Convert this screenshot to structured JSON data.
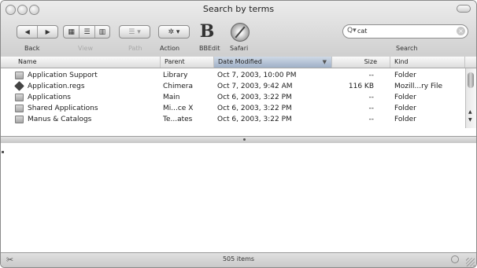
{
  "window": {
    "title": "Search by terms"
  },
  "toolbar": {
    "back_forward_glyphs": [
      "◀",
      "▶"
    ],
    "view_glyphs": [
      "▦",
      "☰",
      "▥"
    ],
    "path_glyph": "☰ ▾",
    "action_glyph": "✲ ▾",
    "bbedit_glyph": "B",
    "labels": {
      "back": "Back",
      "view": "View",
      "path": "Path",
      "action": "Action",
      "bbedit": "BBEdit",
      "safari": "Safari",
      "search": "Search"
    }
  },
  "search": {
    "value": "cat",
    "placeholder": "",
    "glyph": "Q▾",
    "clear_glyph": "×"
  },
  "columns": {
    "name": "Name",
    "parent": "Parent",
    "date_modified": "Date Modified",
    "size": "Size",
    "kind": "Kind",
    "sort_glyph": "▼"
  },
  "files": [
    {
      "name": "Application Support",
      "parent": "Library",
      "date": "Oct 7, 2003, 10:00 PM",
      "size": "--",
      "kind": "Folder",
      "icon": "folder-icon"
    },
    {
      "name": "Application.regs",
      "parent": "Chimera",
      "date": "Oct 7, 2003, 9:42 AM",
      "size": "116 KB",
      "kind": "Mozill...ry File",
      "icon": "application-file-icon"
    },
    {
      "name": "Applications",
      "parent": "Main",
      "date": "Oct 6, 2003, 3:22 PM",
      "size": "--",
      "kind": "Folder",
      "icon": "folder-icon"
    },
    {
      "name": "Shared Applications",
      "parent": "Mi...ce X",
      "date": "Oct 6, 2003, 3:22 PM",
      "size": "--",
      "kind": "Folder",
      "icon": "folder-icon"
    },
    {
      "name": "Manus & Catalogs",
      "parent": "Te...ates",
      "date": "Oct 6, 2003, 3:22 PM",
      "size": "--",
      "kind": "Folder",
      "icon": "folder-icon"
    }
  ],
  "scrollbar": {
    "up_glyph": "▲",
    "down_glyph": "▼"
  },
  "status": {
    "text": "505 items",
    "tools_glyph": "✂"
  }
}
